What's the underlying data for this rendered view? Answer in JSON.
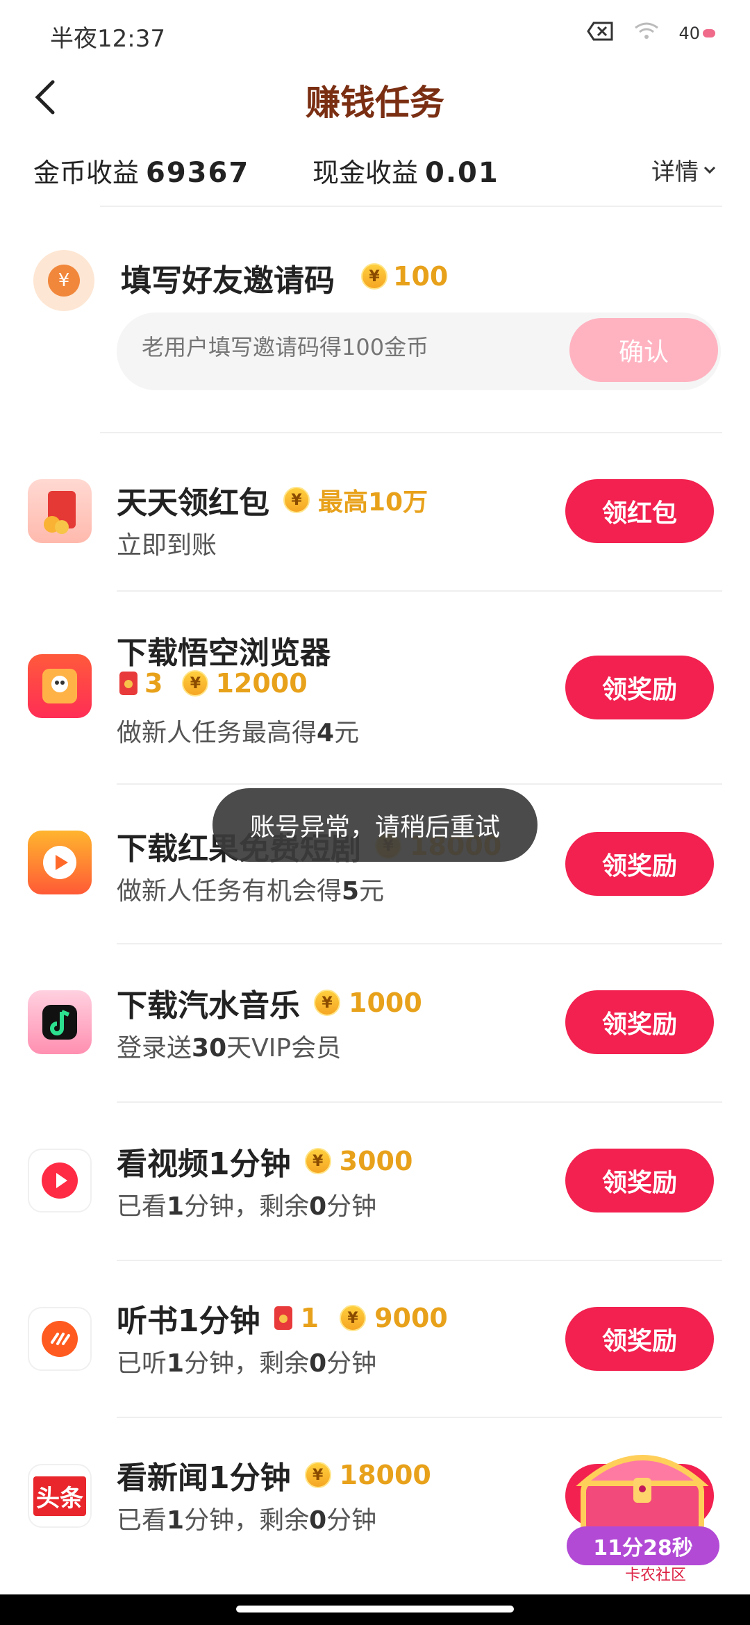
{
  "status_bar": {
    "time": "半夜12:37",
    "battery": "40"
  },
  "header": {
    "title": "赚钱任务",
    "details": "详情"
  },
  "earnings": {
    "coin_label": "金币收益",
    "coin_value": "69367",
    "cash_label": "现金收益",
    "cash_value": "0.01"
  },
  "invite": {
    "title": "填写好友邀请码",
    "reward": "100",
    "placeholder": "老用户填写邀请码得100金币",
    "confirm": "确认"
  },
  "tasks": [
    {
      "title": "天天领红包",
      "reward_text": "最高10万",
      "sub": "立即到账",
      "button": "领红包"
    },
    {
      "title": "下载悟空浏览器",
      "redpack": "3",
      "coins": "12000",
      "sub_pre": "做新人任务最高得",
      "sub_bold": "4",
      "sub_post": "元",
      "button": "领奖励"
    },
    {
      "title": "下载红果免费短剧",
      "coins": "18000",
      "sub_pre": "做新人任务有机会得",
      "sub_bold": "5",
      "sub_post": "元",
      "button": "领奖励"
    },
    {
      "title": "下载汽水音乐",
      "coins": "1000",
      "sub_pre": "登录送",
      "sub_bold": "30",
      "sub_post": "天VIP会员",
      "button": "领奖励"
    },
    {
      "title": "看视频1分钟",
      "coins": "3000",
      "sub_a": "已看",
      "sub_b": "1",
      "sub_c": "分钟，剩余",
      "sub_d": "0",
      "sub_e": "分钟",
      "button": "领奖励"
    },
    {
      "title": "听书1分钟",
      "redpack": "1",
      "coins": "9000",
      "sub_a": "已听",
      "sub_b": "1",
      "sub_c": "分钟，剩余",
      "sub_d": "0",
      "sub_e": "分钟",
      "button": "领奖励"
    },
    {
      "title": "看新闻1分钟",
      "coins": "18000",
      "sub_a": "已看",
      "sub_b": "1",
      "sub_c": "分钟，剩余",
      "sub_d": "0",
      "sub_e": "分钟",
      "icon_text": "头条"
    }
  ],
  "toast": "账号异常，请稍后重试",
  "floating": {
    "timer": "11分28秒",
    "watermark": "卡农社区"
  },
  "colors": {
    "accent": "#f2214f",
    "coin": "#e8a11a",
    "title": "#7a2e12"
  }
}
